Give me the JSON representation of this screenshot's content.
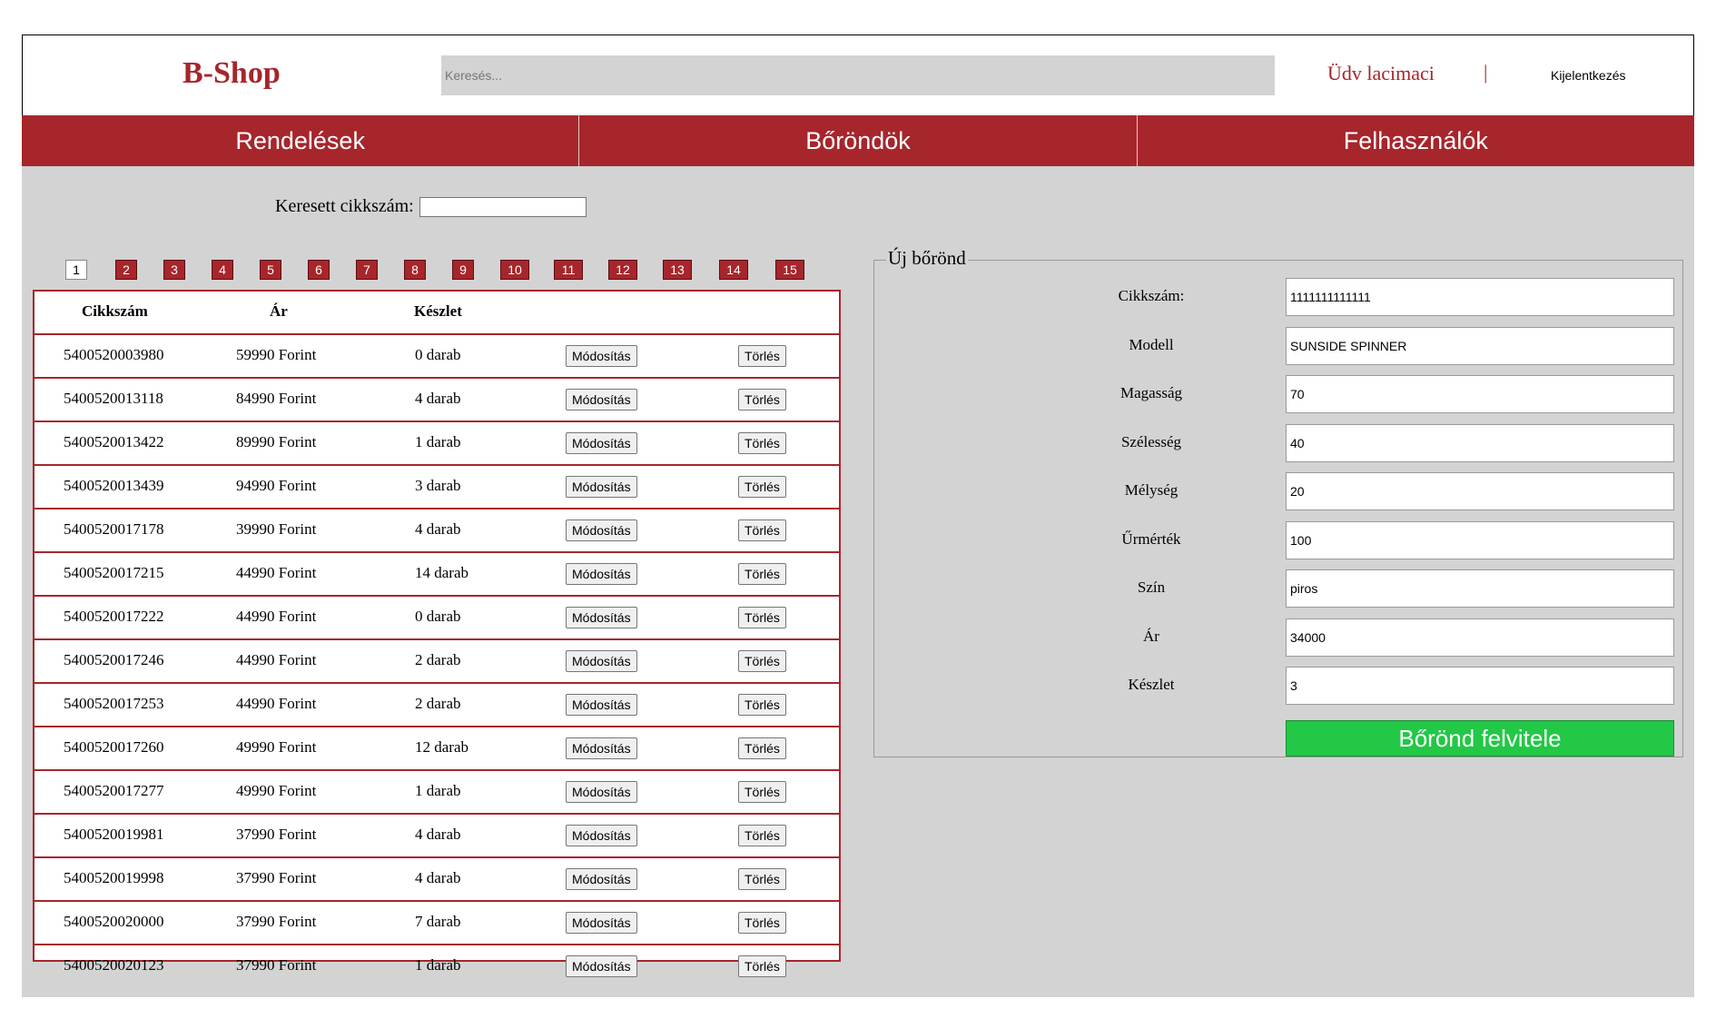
{
  "header": {
    "logo": "B-Shop",
    "search_placeholder": "Keresés...",
    "welcome": "Üdv lacimaci",
    "separator": "|",
    "logout": "Kijelentkezés"
  },
  "nav": {
    "items": [
      "Rendelések",
      "Bőröndök",
      "Felhasználók"
    ]
  },
  "search": {
    "label": "Keresett cikkszám:",
    "value": ""
  },
  "pagination": {
    "active": "1",
    "pages": [
      "1",
      "2",
      "3",
      "4",
      "5",
      "6",
      "7",
      "8",
      "9",
      "10",
      "11",
      "12",
      "13",
      "14",
      "15"
    ]
  },
  "table": {
    "headers": {
      "sku": "Cikkszám",
      "price": "Ár",
      "stock": "Készlet"
    },
    "modify_label": "Módosítás",
    "delete_label": "Törlés",
    "rows": [
      {
        "sku": "5400520003980",
        "price": "59990 Forint",
        "stock": "0 darab"
      },
      {
        "sku": "5400520013118",
        "price": "84990 Forint",
        "stock": "4 darab"
      },
      {
        "sku": "5400520013422",
        "price": "89990 Forint",
        "stock": "1 darab"
      },
      {
        "sku": "5400520013439",
        "price": "94990 Forint",
        "stock": "3 darab"
      },
      {
        "sku": "5400520017178",
        "price": "39990 Forint",
        "stock": "4 darab"
      },
      {
        "sku": "5400520017215",
        "price": "44990 Forint",
        "stock": "14 darab"
      },
      {
        "sku": "5400520017222",
        "price": "44990 Forint",
        "stock": "0 darab"
      },
      {
        "sku": "5400520017246",
        "price": "44990 Forint",
        "stock": "2 darab"
      },
      {
        "sku": "5400520017253",
        "price": "44990 Forint",
        "stock": "2 darab"
      },
      {
        "sku": "5400520017260",
        "price": "49990 Forint",
        "stock": "12 darab"
      },
      {
        "sku": "5400520017277",
        "price": "49990 Forint",
        "stock": "1 darab"
      },
      {
        "sku": "5400520019981",
        "price": "37990 Forint",
        "stock": "4 darab"
      },
      {
        "sku": "5400520019998",
        "price": "37990 Forint",
        "stock": "4 darab"
      },
      {
        "sku": "5400520020000",
        "price": "37990 Forint",
        "stock": "7 darab"
      },
      {
        "sku": "5400520020123",
        "price": "37990 Forint",
        "stock": "1 darab"
      }
    ]
  },
  "new_item": {
    "legend": "Új bőrönd",
    "fields": [
      {
        "label": "Cikkszám:",
        "value": "1111111111111"
      },
      {
        "label": "Modell",
        "value": "SUNSIDE SPINNER"
      },
      {
        "label": "Magasság",
        "value": "70"
      },
      {
        "label": "Szélesség",
        "value": "40"
      },
      {
        "label": "Mélység",
        "value": "20"
      },
      {
        "label": "Űrmérték",
        "value": "100"
      },
      {
        "label": "Szín",
        "value": "piros"
      },
      {
        "label": "Ár",
        "value": "34000"
      },
      {
        "label": "Készlet",
        "value": "3"
      }
    ],
    "submit_label": "Bőrönd felvitele"
  },
  "colors": {
    "accent": "#a6262c",
    "submit": "#22c846",
    "background": "#d3d3d3"
  }
}
